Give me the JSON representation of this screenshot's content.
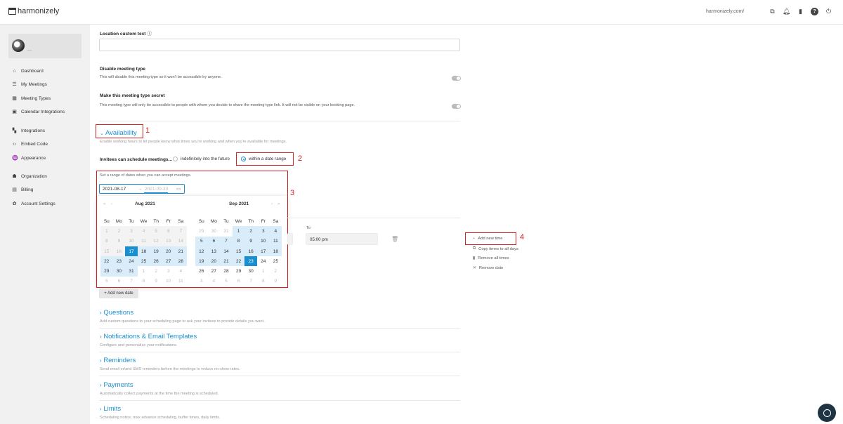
{
  "app": {
    "name": "harmonizely"
  },
  "topbar": {
    "url": "harmonizely.com/",
    "icons": [
      "copy-icon",
      "bell-icon",
      "chat-icon",
      "help-icon",
      "power-icon"
    ]
  },
  "sidebar": {
    "items": [
      {
        "label": "Dashboard",
        "icon": "home-icon"
      },
      {
        "label": "My Meetings",
        "icon": "list-icon"
      },
      {
        "label": "Meeting Types",
        "icon": "grid-icon"
      },
      {
        "label": "Calendar Integrations",
        "icon": "calendar-icon"
      },
      {
        "label": "Integrations",
        "icon": "puzzle-icon"
      },
      {
        "label": "Embed Code",
        "icon": "code-icon"
      },
      {
        "label": "Appearance",
        "icon": "brush-icon"
      },
      {
        "label": "Organization",
        "icon": "people-icon"
      },
      {
        "label": "Billing",
        "icon": "receipt-icon"
      },
      {
        "label": "Account Settings",
        "icon": "gear-icon"
      }
    ]
  },
  "location": {
    "label": "Location custom text",
    "value": ""
  },
  "disable": {
    "label": "Disable meeting type",
    "desc": "This will disable this meeting type so it won't be accessible by anyone."
  },
  "secret": {
    "label": "Make this meeting type secret",
    "desc": "This meeting type will only be accessible to people with whom you decide to share the meeting type link. It will not be visible on your booking page."
  },
  "availability": {
    "title": "Availability",
    "desc": "Enable working hours to let people know what times you're working and when you're available for meetings.",
    "schedule_label": "Invitees can schedule meetings...",
    "option_indef": "indefinitely into the future",
    "option_range": "within a date range",
    "range_hint": "Set a range of dates when you can accept meetings.",
    "start_date": "2021-08-17",
    "end_date": "2021-09-23",
    "to_label": "To",
    "to_time": "05:00 pm",
    "add_date": "+ Add new date"
  },
  "calendar": {
    "left_title": "Aug  2021",
    "right_title": "Sep  2021",
    "weekdays": [
      "Su",
      "Mo",
      "Tu",
      "We",
      "Th",
      "Fr",
      "Sa"
    ],
    "left_days": [
      "1",
      "2",
      "3",
      "4",
      "5",
      "6",
      "7",
      "8",
      "9",
      "10",
      "11",
      "12",
      "13",
      "14",
      "15",
      "16",
      "17",
      "18",
      "19",
      "20",
      "21",
      "22",
      "23",
      "24",
      "25",
      "26",
      "27",
      "28",
      "29",
      "30",
      "31",
      "1",
      "2",
      "3",
      "4",
      "5",
      "6",
      "7",
      "8",
      "9",
      "10",
      "11"
    ],
    "right_days": [
      "29",
      "30",
      "31",
      "1",
      "2",
      "3",
      "4",
      "5",
      "6",
      "7",
      "8",
      "9",
      "10",
      "11",
      "12",
      "13",
      "14",
      "15",
      "16",
      "17",
      "18",
      "19",
      "20",
      "21",
      "22",
      "23",
      "24",
      "25",
      "26",
      "27",
      "28",
      "29",
      "30",
      "1",
      "2",
      "3",
      "4",
      "5",
      "6",
      "7",
      "8",
      "9"
    ]
  },
  "times_panel": {
    "add_time": "Add new time",
    "copy_all": "Copy times to all days",
    "remove_all": "Remove all times",
    "remove_date": "Remove date"
  },
  "sections": [
    {
      "title": "Questions",
      "desc": "Add custom questions to your scheduling page to ask your invitees to provide details you want."
    },
    {
      "title": "Notifications & Email Templates",
      "desc": "Configure and personalize your notifications."
    },
    {
      "title": "Reminders",
      "desc": "Send email or/and SMS reminders before the meetings to reduce no-show rates."
    },
    {
      "title": "Payments",
      "desc": "Automatically collect payments at the time the meeting is scheduled."
    },
    {
      "title": "Limits",
      "desc": "Scheduling notice, max advance scheduling, buffer times, daily limits."
    }
  ],
  "annotations": [
    "1",
    "2",
    "3",
    "4"
  ],
  "colors": {
    "accent": "#1a8fd0",
    "annotation": "#d62020"
  }
}
